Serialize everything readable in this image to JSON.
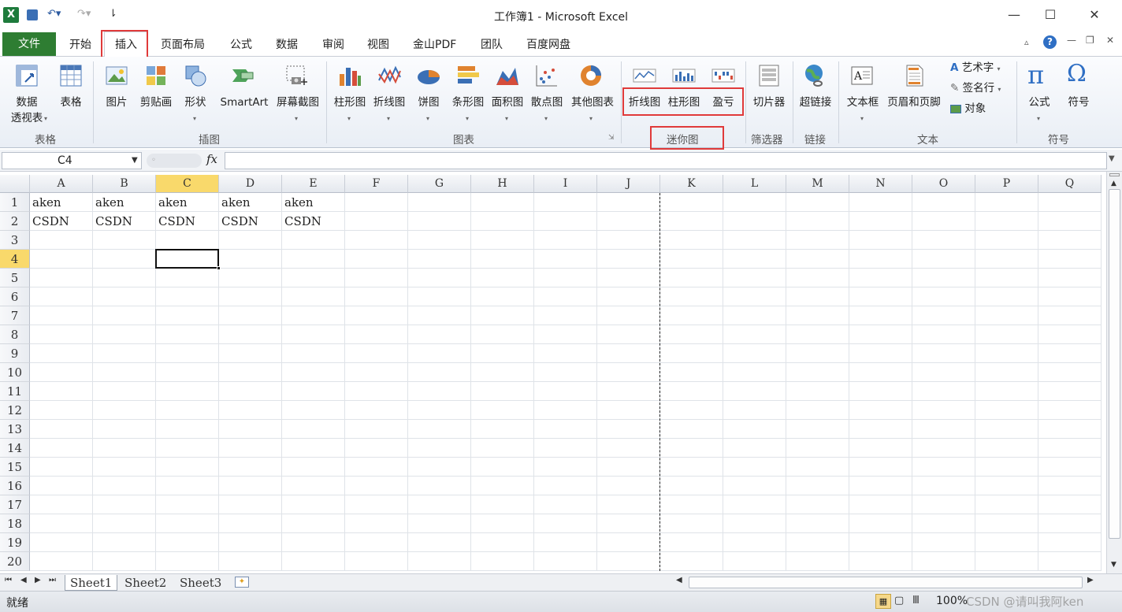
{
  "app": {
    "title": "工作簿1 - Microsoft Excel"
  },
  "window": {
    "minimize": "—",
    "maximize": "☐",
    "close": "✕"
  },
  "tabs": [
    {
      "label": "文件"
    },
    {
      "label": "开始"
    },
    {
      "label": "插入"
    },
    {
      "label": "页面布局"
    },
    {
      "label": "公式"
    },
    {
      "label": "数据"
    },
    {
      "label": "审阅"
    },
    {
      "label": "视图"
    },
    {
      "label": "金山PDF"
    },
    {
      "label": "团队"
    },
    {
      "label": "百度网盘"
    }
  ],
  "ribbon": {
    "groups": {
      "tables": "表格",
      "illustrations": "插图",
      "charts": "图表",
      "sparklines": "迷你图",
      "filter": "筛选器",
      "links": "链接",
      "text": "文本",
      "symbols": "符号"
    },
    "buttons": {
      "pivot_line1": "数据",
      "pivot_line2": "透视表",
      "table": "表格",
      "picture": "图片",
      "clipart": "剪贴画",
      "shapes": "形状",
      "smartart": "SmartArt",
      "screenshot": "屏幕截图",
      "column": "柱形图",
      "line": "折线图",
      "pie": "饼图",
      "bar": "条形图",
      "area": "面积图",
      "scatter": "散点图",
      "other": "其他图表",
      "spark_line": "折线图",
      "spark_column": "柱形图",
      "spark_winloss": "盈亏",
      "slicer": "切片器",
      "hyperlink": "超链接",
      "textbox": "文本框",
      "header_footer": "页眉和页脚",
      "wordart": "艺术字",
      "signature": "签名行",
      "object": "对象",
      "equation": "公式",
      "symbol": "符号"
    }
  },
  "formula_bar": {
    "name_box": "C4",
    "fx": "fx",
    "value": ""
  },
  "grid": {
    "columns": [
      "A",
      "B",
      "C",
      "D",
      "E",
      "F",
      "G",
      "H",
      "I",
      "J",
      "K",
      "L",
      "M",
      "N",
      "O",
      "P",
      "Q"
    ],
    "rows": [
      "1",
      "2",
      "3",
      "4",
      "5",
      "6",
      "7",
      "8",
      "9",
      "10",
      "11",
      "12",
      "13",
      "14",
      "15",
      "16",
      "17",
      "18",
      "19",
      "20"
    ],
    "cells": {
      "A1": "aken",
      "B1": "aken",
      "C1": "aken",
      "D1": "aken",
      "E1": "aken",
      "A2": "CSDN",
      "B2": "CSDN",
      "C2": "CSDN",
      "D2": "CSDN",
      "E2": "CSDN"
    },
    "active_cell": "C4"
  },
  "sheets": [
    {
      "label": "Sheet1"
    },
    {
      "label": "Sheet2"
    },
    {
      "label": "Sheet3"
    }
  ],
  "status": {
    "ready": "就绪",
    "zoom": "100%",
    "watermark": "CSDN @请叫我阿ken"
  },
  "colors": {
    "file_tab": "#2e7d32",
    "highlight": "#e03a3a",
    "active_header": "#f9d96b"
  }
}
